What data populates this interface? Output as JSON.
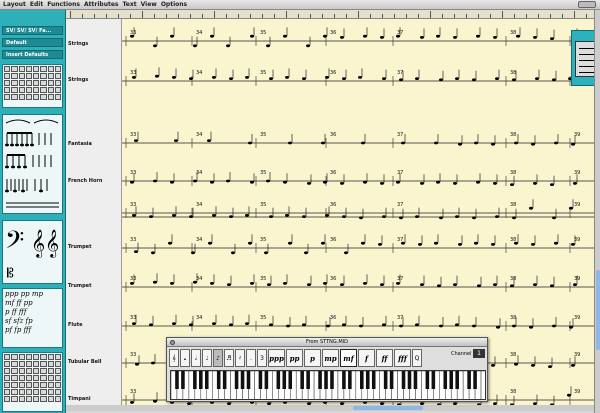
{
  "menu": {
    "items": [
      "Layout",
      "Edit",
      "Functions",
      "Attributes",
      "Text",
      "View",
      "Options"
    ]
  },
  "palette": {
    "selector_label": "SV/ SV/ SV/ Fa...",
    "default_label": "Default",
    "insert_defaults_label": "Insert Defaults",
    "dynamics_rows": [
      "ppp pp mp",
      "mf ff pp",
      "p ff fff",
      "sf sfz fp",
      "pf fp fff"
    ]
  },
  "score": {
    "instruments": [
      "Strings",
      "Strings",
      "Fantasia",
      "French Horn",
      "Trumpet",
      "Trumpet",
      "Flute",
      "Tubular Bell",
      "Timpani"
    ],
    "bar_numbers": [
      "33",
      "34",
      "35",
      "36",
      "37",
      "38",
      "39"
    ]
  },
  "midi_window": {
    "title": "From STTNG.MID",
    "dynamics": [
      "ppp",
      "pp",
      "p",
      "mp",
      "mf",
      "f",
      "ff",
      "fff"
    ],
    "selected_dynamic": "mf",
    "channel_label": "Channel",
    "channel_value": "1"
  },
  "colors": {
    "accent": "#2fb0b8",
    "paper": "#fbf5cf"
  }
}
